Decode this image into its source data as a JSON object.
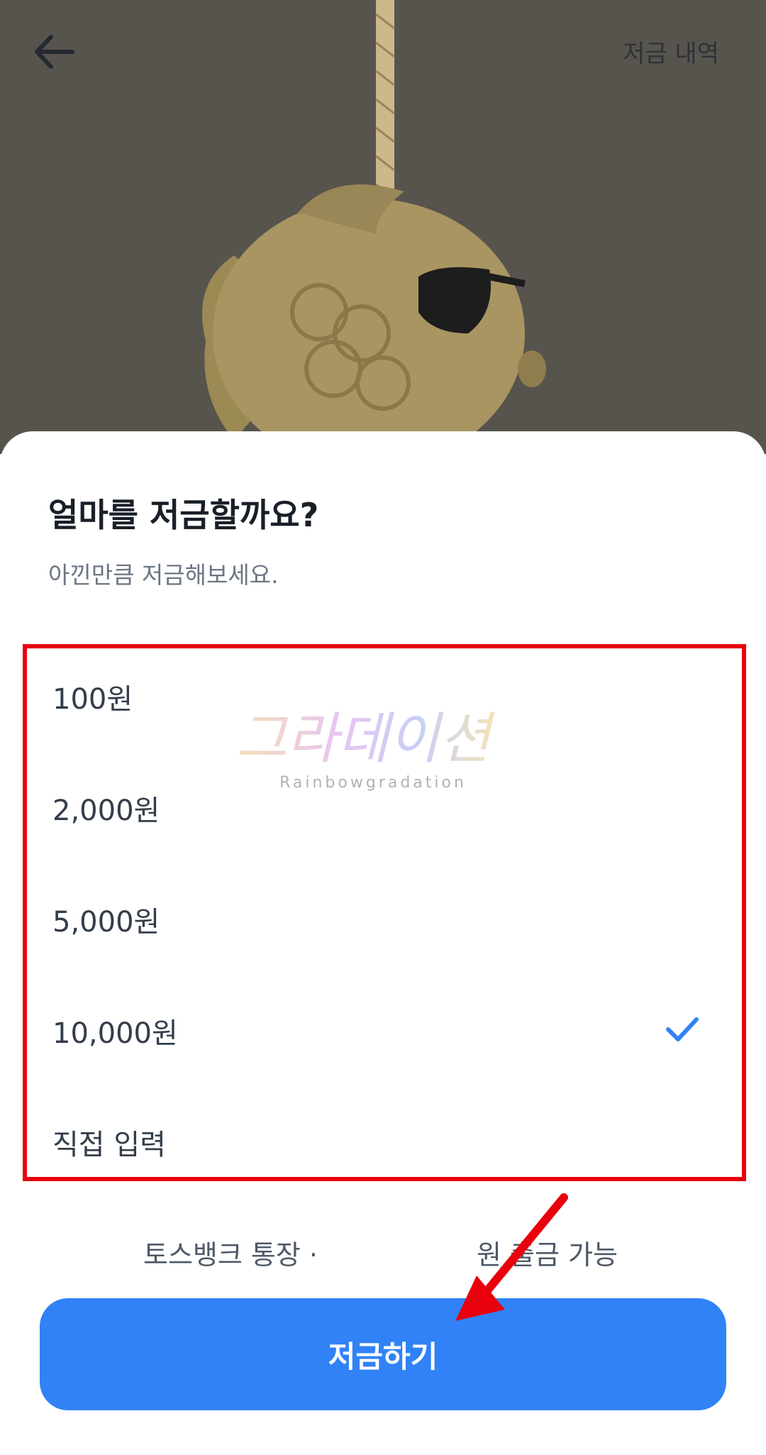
{
  "header": {
    "back_icon": "arrow-left-icon",
    "history_label": "저금 내역"
  },
  "sheet": {
    "title": "얼마를 저금할까요?",
    "subtitle": "아낀만큼 저금해보세요."
  },
  "options": [
    {
      "label": "100원",
      "selected": false
    },
    {
      "label": "2,000원",
      "selected": false
    },
    {
      "label": "5,000원",
      "selected": false
    },
    {
      "label": "10,000원",
      "selected": true
    },
    {
      "label": "직접 입력",
      "selected": false
    }
  ],
  "watermark": {
    "main": "그라데이션",
    "sub": "Rainbowgradation"
  },
  "balance": {
    "left_text": "토스뱅크 통장 ·",
    "right_text": "원 출금 가능"
  },
  "submit_label": "저금하기",
  "colors": {
    "accent": "#3182f6",
    "annotation": "#e8000d",
    "hero_bg": "#57544e"
  }
}
